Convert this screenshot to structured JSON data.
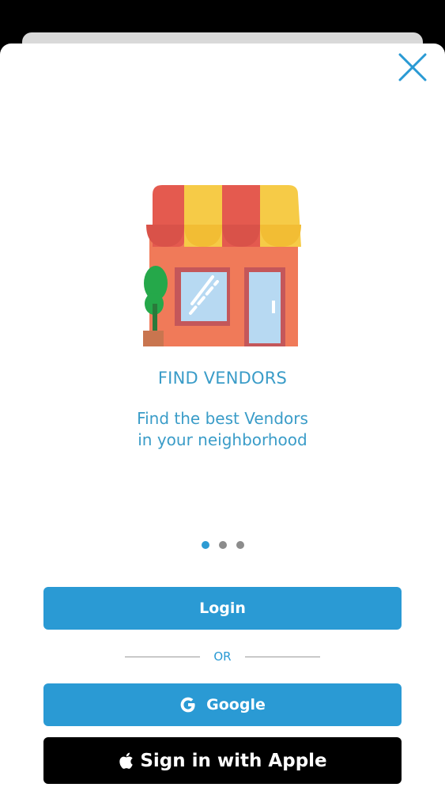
{
  "header": {
    "close_icon": "close-icon"
  },
  "slide": {
    "illustration_icon": "storefront-icon",
    "title": "FIND VENDORS",
    "description_line1": "Find the best Vendors",
    "description_line2": "in your neighborhood"
  },
  "pagination": {
    "total": 3,
    "active_index": 0
  },
  "actions": {
    "login_label": "Login",
    "or_label": "OR",
    "google_label": "Google",
    "google_icon": "google-g-icon",
    "apple_label": "Sign in with Apple",
    "apple_icon": "apple-logo-icon"
  },
  "colors": {
    "accent": "#2a9ad4",
    "text_accent": "#3a9cc8",
    "apple_button": "#000000",
    "dot_inactive": "#8c8c8c"
  }
}
